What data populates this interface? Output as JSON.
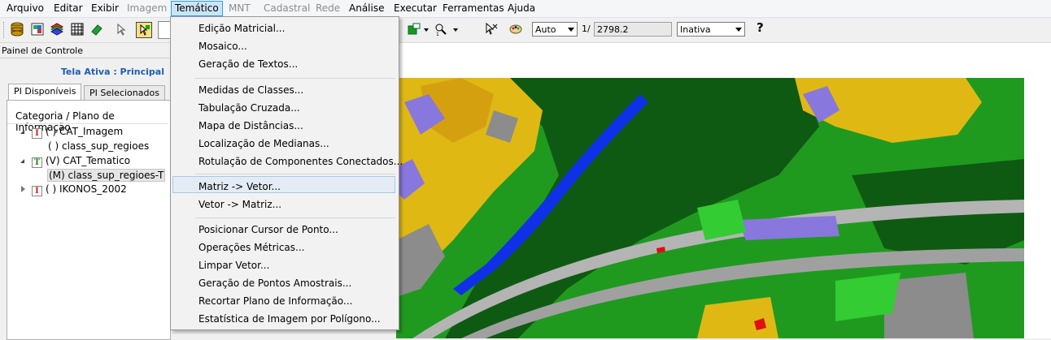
{
  "menubar": {
    "items": [
      {
        "label": "Arquivo",
        "enabled": true
      },
      {
        "label": "Editar",
        "enabled": true
      },
      {
        "label": "Exibir",
        "enabled": true
      },
      {
        "label": "Imagem",
        "enabled": false
      },
      {
        "label": "Temático",
        "enabled": true,
        "active": true
      },
      {
        "label": "MNT",
        "enabled": false
      },
      {
        "label": "Cadastral",
        "enabled": false
      },
      {
        "label": "Rede",
        "enabled": false
      },
      {
        "label": "Análise",
        "enabled": true
      },
      {
        "label": "Executar",
        "enabled": true
      },
      {
        "label": "Ferramentas",
        "enabled": true
      },
      {
        "label": "Ajuda",
        "enabled": true
      }
    ]
  },
  "toolbar": {
    "zoom_mode": "Auto",
    "scale_prefix": "1/",
    "scale_value": "2798.2",
    "state": "Inativa",
    "help_icon": "question-mark-icon"
  },
  "panel": {
    "title": "Painel de Controle",
    "active_view": "Tela Ativa : Principal",
    "tabs": [
      "PI Disponíveis",
      "PI Selecionados"
    ],
    "tree_header": "Categoria / Plano de Informação",
    "tree": [
      {
        "marker": "I",
        "label": "( ) CAT_Imagem",
        "expanded": true
      },
      {
        "label": "( ) class_sup_regioes"
      },
      {
        "marker": "T",
        "label": "(V) CAT_Tematico",
        "expanded": true
      },
      {
        "label": "(M) class_sup_regioes-T",
        "selected": true
      },
      {
        "marker": "I",
        "label": "( ) IKONOS_2002",
        "expanded": false
      }
    ]
  },
  "dropdown": {
    "groups": [
      [
        "Edição Matricial...",
        "Mosaico...",
        "Geração de Textos..."
      ],
      [
        "Medidas de Classes...",
        "Tabulação Cruzada...",
        "Mapa de Distâncias...",
        "Localização de Medianas...",
        "Rotulação de Componentes Conectados..."
      ],
      [
        "Matriz -> Vetor...",
        "Vetor -> Matriz..."
      ],
      [
        "Posicionar Cursor de Ponto...",
        "Operações Métricas...",
        "Limpar Vetor...",
        "Geração de Pontos Amostrais...",
        "Recortar Plano de Informação...",
        "Estatística de Imagem por Polígono..."
      ]
    ],
    "highlighted": "Matriz -> Vetor..."
  },
  "map_colors": {
    "dark_green": "#0f5a12",
    "green": "#1f9a1f",
    "light_green": "#33cc33",
    "yellow": "#e0b814",
    "water": "#1030e8",
    "purple": "#8877dd",
    "gray": "#8c8c8c",
    "light_gray": "#b4b4b4",
    "red": "#e01010"
  }
}
